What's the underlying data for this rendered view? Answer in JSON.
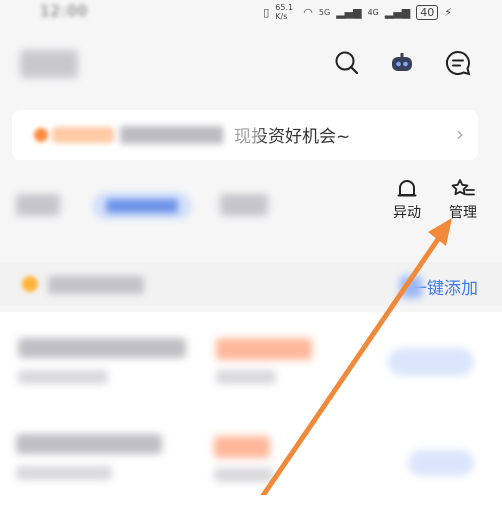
{
  "status": {
    "battery": "40",
    "net_speed": "65.1 K/s",
    "sig1": "5G",
    "sig2": "4G",
    "charge": "⚡"
  },
  "banner": {
    "text": "现投资好机会~",
    "chevron": "›"
  },
  "actions": {
    "movement_label": "异动",
    "manage_label": "管理"
  },
  "section": {
    "add_all_label": "一键添加"
  },
  "colors": {
    "accent": "#3d7af5",
    "arrow": "#f08a3a"
  },
  "icons": {
    "search": "search-icon",
    "robot": "robot-icon",
    "message": "message-icon",
    "bell": "bell-icon",
    "star_list": "star-list-icon"
  }
}
